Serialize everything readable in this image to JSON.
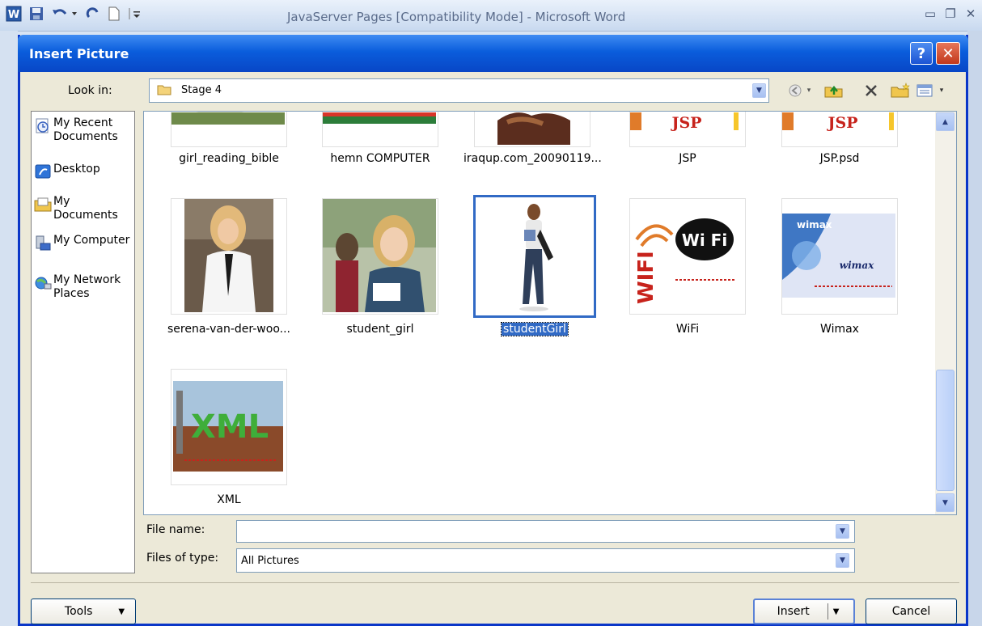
{
  "word": {
    "title": "JavaServer Pages [Compatibility Mode] - Microsoft Word"
  },
  "dialog": {
    "title": "Insert Picture",
    "help": "?",
    "close": "✕",
    "look_in_label": "Look in:",
    "look_in_value": "Stage 4",
    "places": [
      {
        "label": "My Recent Documents",
        "icon": "recent-documents-icon"
      },
      {
        "label": "Desktop",
        "icon": "desktop-icon"
      },
      {
        "label": "My Documents",
        "icon": "my-documents-icon"
      },
      {
        "label": "My Computer",
        "icon": "my-computer-icon"
      },
      {
        "label": "My Network Places",
        "icon": "network-places-icon"
      }
    ],
    "files": [
      {
        "name": "girl_reading_bible"
      },
      {
        "name": "hemn COMPUTER"
      },
      {
        "name": "iraqup.com_20090119..."
      },
      {
        "name": "JSP"
      },
      {
        "name": "JSP.psd"
      },
      {
        "name": "serena-van-der-woo..."
      },
      {
        "name": "student_girl"
      },
      {
        "name": "studentGirl",
        "selected": true
      },
      {
        "name": "WiFi"
      },
      {
        "name": "Wimax"
      },
      {
        "name": "XML"
      }
    ],
    "file_name_label": "File name:",
    "file_name_value": "",
    "files_of_type_label": "Files of type:",
    "files_of_type_value": "All Pictures",
    "tools_label": "Tools",
    "insert_label": "Insert",
    "cancel_label": "Cancel"
  },
  "thumb_text": {
    "jsp": "JSP",
    "wifi": "Wi Fi",
    "wimax": "wimax",
    "xml": "XML"
  },
  "colors": {
    "title_blue": "#0a5ddc",
    "selection": "#316ac5"
  }
}
